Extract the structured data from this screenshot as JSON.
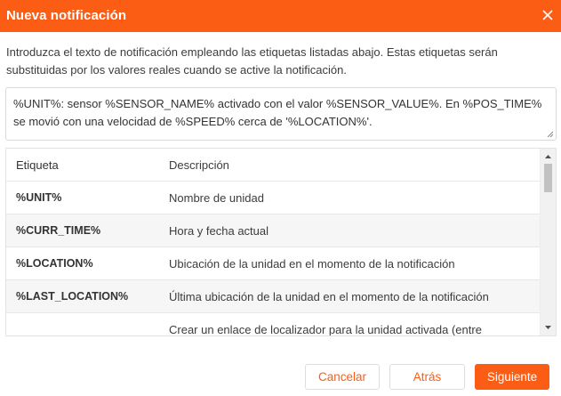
{
  "dialog": {
    "title": "Nueva notificación",
    "close_icon": "close-icon",
    "intro_text": "Introduzca el texto de notificación empleando las etiquetas listadas abajo. Estas etiquetas serán substituidas por los valores reales cuando se active la notificación.",
    "template_text": "%UNIT%: sensor %SENSOR_NAME% activado con el valor %SENSOR_VALUE%. En %POS_TIME% se movió con una velocidad de %SPEED% cerca de '%LOCATION%'.",
    "table": {
      "headers": {
        "tag": "Etiqueta",
        "description": "Descripción"
      },
      "rows": [
        {
          "tag": "%UNIT%",
          "description": "Nombre de unidad"
        },
        {
          "tag": "%CURR_TIME%",
          "description": "Hora y fecha actual"
        },
        {
          "tag": "%LOCATION%",
          "description": "Ubicación de la unidad en el momento de la notificación"
        },
        {
          "tag": "%LAST_LOCATION%",
          "description": "Última ubicación de la unidad en el momento de la notificación"
        },
        {
          "tag": "",
          "description": "Crear un enlace de localizador para la unidad activada (entre"
        }
      ]
    },
    "buttons": {
      "cancel": "Cancelar",
      "back": "Atrás",
      "next": "Siguiente"
    },
    "colors": {
      "accent": "#fc5d15",
      "row_alt": "#f6f6f6",
      "border": "#d9d9d9"
    }
  }
}
